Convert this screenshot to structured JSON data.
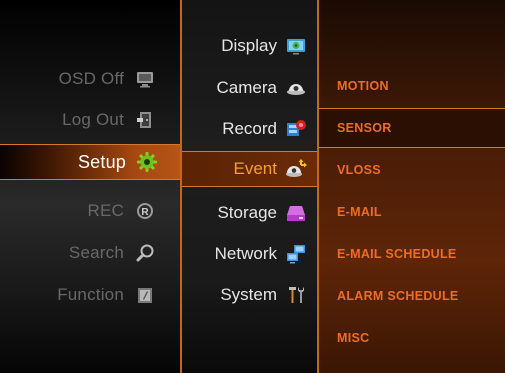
{
  "main_menu": {
    "items": [
      {
        "label": "OSD Off",
        "icon": "monitor-icon",
        "active": false
      },
      {
        "label": "Log Out",
        "icon": "logout-door-icon",
        "active": false
      },
      {
        "label": "Setup",
        "icon": "gear-icon",
        "active": true
      },
      {
        "label": "REC",
        "icon": "record-r-icon",
        "active": false
      },
      {
        "label": "Search",
        "icon": "magnifier-icon",
        "active": false
      },
      {
        "label": "Function",
        "icon": "function-icon",
        "active": false
      }
    ]
  },
  "setup_menu": {
    "items": [
      {
        "label": "Display",
        "icon": "display-settings-icon",
        "active": false
      },
      {
        "label": "Camera",
        "icon": "dome-camera-icon",
        "active": false
      },
      {
        "label": "Record",
        "icon": "record-flag-icon",
        "active": false
      },
      {
        "label": "Event",
        "icon": "event-camera-move-icon",
        "active": true
      },
      {
        "label": "Storage",
        "icon": "storage-drive-icon",
        "active": false
      },
      {
        "label": "Network",
        "icon": "network-computers-icon",
        "active": false
      },
      {
        "label": "System",
        "icon": "system-tools-icon",
        "active": false
      }
    ]
  },
  "event_menu": {
    "items": [
      {
        "label": "MOTION",
        "active": false
      },
      {
        "label": "SENSOR",
        "active": true
      },
      {
        "label": "VLOSS",
        "active": false
      },
      {
        "label": "E-MAIL",
        "active": false
      },
      {
        "label": "E-MAIL SCHEDULE",
        "active": false
      },
      {
        "label": "ALARM SCHEDULE",
        "active": false
      },
      {
        "label": "MISC",
        "active": false
      }
    ]
  },
  "colors": {
    "accent": "#c9641b",
    "event_text": "#ee6d22",
    "active_sub_text": "#f5a030"
  }
}
